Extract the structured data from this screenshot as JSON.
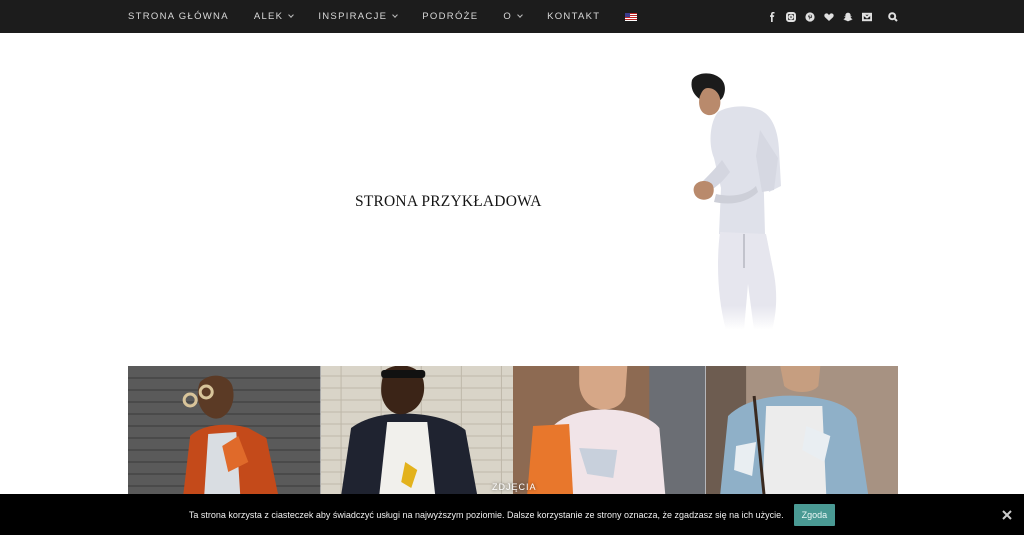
{
  "nav": {
    "items": [
      {
        "label": "STRONA GŁÓWNA",
        "has_dropdown": false
      },
      {
        "label": "ALEK",
        "has_dropdown": true
      },
      {
        "label": "INSPIRACJE",
        "has_dropdown": true
      },
      {
        "label": "PODRÓŻE",
        "has_dropdown": false
      },
      {
        "label": "O",
        "has_dropdown": true
      },
      {
        "label": "KONTAKT",
        "has_dropdown": false
      }
    ],
    "language_icon": "us-flag-icon"
  },
  "social": [
    "facebook-icon",
    "instagram-icon",
    "pinterest-icon",
    "heart-icon",
    "snapchat-icon",
    "mail-icon",
    "search-icon"
  ],
  "header": {
    "title": "STRONA PRZYKŁADOWA"
  },
  "gallery": {
    "caption": "ZDJĘCIA"
  },
  "cookie": {
    "text": "Ta strona korzysta z ciasteczek aby świadczyć usługi na najwyższym poziomie. Dalsze korzystanie ze strony oznacza, że zgadzasz się na ich użycie.",
    "accept_label": "Zgoda"
  },
  "colors": {
    "topbar": "#1c1c1c",
    "accent": "#4a9a94",
    "cookie_bg": "#000000"
  }
}
